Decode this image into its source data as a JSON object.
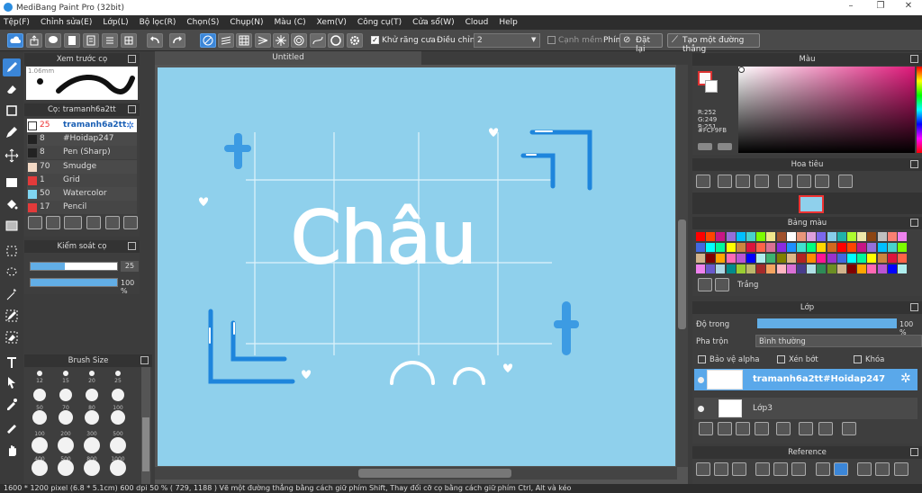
{
  "window": {
    "title": "MediBang Paint Pro (32bit)"
  },
  "menu": [
    "Tệp(F)",
    "Chỉnh sửa(E)",
    "Lớp(L)",
    "Bộ lọc(R)",
    "Chọn(S)",
    "Chụp(N)",
    "Màu (C)",
    "Xem(V)",
    "Công cụ(T)",
    "Cửa sổ(W)",
    "Cloud",
    "Help"
  ],
  "toolbar": {
    "antialias_label": "Khử răng cưa",
    "adjust_label": "Điều chỉnh",
    "adjust_value": "2",
    "smooth_edge_label": "Cạnh mềm",
    "key_label": "Phím",
    "reset_label": "Đặt lại",
    "straight_label": "Tạo một đường thẳng"
  },
  "document": {
    "tab_title": "Untitled"
  },
  "brush_preview": {
    "title": "Xem trước cọ",
    "size_label": "1.06mm"
  },
  "brush_list": {
    "title": "Cọ: tramanh6a2tt",
    "items": [
      {
        "size": "25",
        "name": "tramanh6a2tt",
        "color": "#3a7ad8",
        "selected": true
      },
      {
        "size": "8",
        "name": "#Hoidap247",
        "color": "#222222",
        "selected": false
      },
      {
        "size": "8",
        "name": "Pen (Sharp)",
        "color": "#222222",
        "selected": false
      },
      {
        "size": "70",
        "name": "Smudge",
        "color": "#f3d9c5",
        "selected": false
      },
      {
        "size": "1",
        "name": "Grid",
        "color": "#e33a3a",
        "selected": false
      },
      {
        "size": "50",
        "name": "Watercolor",
        "color": "#7fd6f2",
        "selected": false
      },
      {
        "size": "17",
        "name": "Pencil",
        "color": "#e33a3a",
        "selected": false
      }
    ]
  },
  "brush_control": {
    "title": "Kiểm soát cọ",
    "size_value": "25",
    "opacity_value": "100 %",
    "size_fraction": 0.4,
    "opacity_fraction": 1.0
  },
  "brush_size": {
    "title": "Brush Size",
    "rows": [
      [
        "12",
        "15",
        "20",
        "25"
      ],
      [
        "",
        "",
        "",
        ""
      ],
      [
        "50",
        "70",
        "80",
        "100"
      ],
      [
        "",
        "",
        "",
        ""
      ],
      [
        "100",
        "200",
        "300",
        "500"
      ],
      [
        "",
        "",
        "",
        ""
      ],
      [
        "400",
        "500",
        "800",
        "1000"
      ]
    ]
  },
  "canvas": {
    "text": "Châu"
  },
  "color_panel": {
    "title": "Màu",
    "r": "R:252",
    "g": "G:249",
    "b": "B:251",
    "hex": "#FCF9FB"
  },
  "navigator": {
    "title": "Hoa tiêu"
  },
  "palette": {
    "title": "Bảng màu",
    "name": "Trắng"
  },
  "layers": {
    "title": "Lớp",
    "opacity_label": "Độ trong",
    "opacity_value": "100 %",
    "opacity_fraction": 1.0,
    "blend_label": "Pha trộn",
    "blend_value": "Bình thường",
    "protect_alpha": "Bảo vệ alpha",
    "clipping": "Xén bớt",
    "lock": "Khóa",
    "items": [
      {
        "name": "tramanh6a2tt#Hoidap247",
        "selected": true
      },
      {
        "name": "Lớp3",
        "selected": false
      }
    ]
  },
  "reference": {
    "title": "Reference"
  },
  "status": {
    "text": "1600 * 1200 pixel  (6.8 * 5.1cm)  600 dpi  50 %  ( 729, 1188 )  Vẽ một đường thẳng bằng cách giữ phím Shift, Thay đổi cỡ cọ bằng cách giữ phím Ctrl, Alt và kéo"
  }
}
